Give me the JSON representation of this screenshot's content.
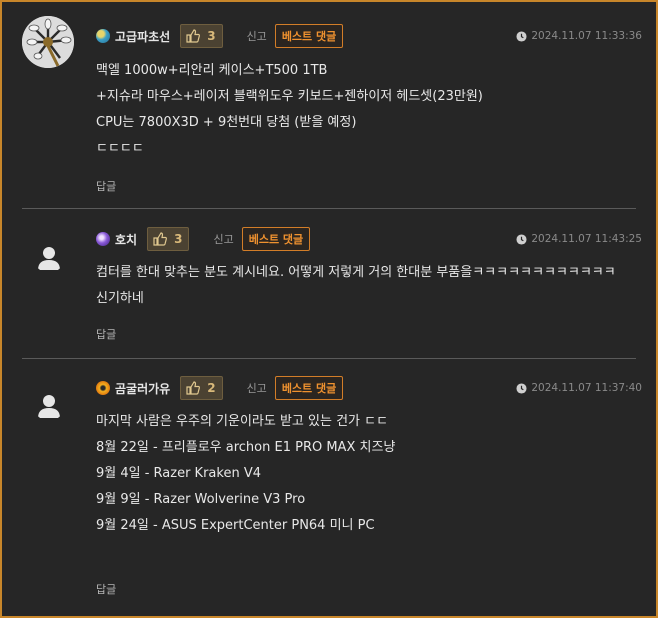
{
  "comments": [
    {
      "nickname": "고급파초선",
      "likes": "3",
      "report_label": "신고",
      "best_label": "베스트 댓글",
      "timestamp": "2024.11.07 11:33:36",
      "lines": [
        "맥엘 1000w+리안리 케이스+T500 1TB",
        "+지슈라 마우스+레이저 블랙위도우 키보드+젠하이저 헤드셋(23만원)",
        "CPU는 7800X3D + 9천번대 당첨 (받을 예정)",
        "ㄷㄷㄷㄷ"
      ],
      "reply_label": "답글"
    },
    {
      "nickname": "호치",
      "likes": "3",
      "report_label": "신고",
      "best_label": "베스트 댓글",
      "timestamp": "2024.11.07 11:43:25",
      "lines": [
        "컴터를 한대 맞추는 분도 계시네요. 어떻게 저렇게 거의 한대분 부품을ㅋㅋㅋㅋㅋㅋㅋㅋㅋㅋㅋㅋ 신기하네"
      ],
      "reply_label": "답글"
    },
    {
      "nickname": "곰굴러가유",
      "likes": "2",
      "report_label": "신고",
      "best_label": "베스트 댓글",
      "timestamp": "2024.11.07 11:37:40",
      "lines": [
        "마지막 사람은 우주의 기운이라도 받고 있는 건가 ㄷㄷ",
        "8월 22일 - 프리플로우 archon E1 PRO MAX 치즈냥",
        "9월 4일  - Razer Kraken V4",
        "9월 9일 - Razer Wolverine V3 Pro",
        "9월 24일  - ASUS ExpertCenter PN64 미니 PC"
      ],
      "reply_label": "답글"
    }
  ],
  "colors": {
    "frame_border": "#c8862a",
    "badge": "#f0922f",
    "like_count": "#d9b97a"
  },
  "icons": {
    "level_1": "globe-level-icon",
    "level_2": "purple-orb-level-icon",
    "level_3": "orange-swirl-level-icon",
    "like": "thumbs-up-icon",
    "clock": "clock-icon",
    "default_avatar": "person-silhouette-icon"
  }
}
